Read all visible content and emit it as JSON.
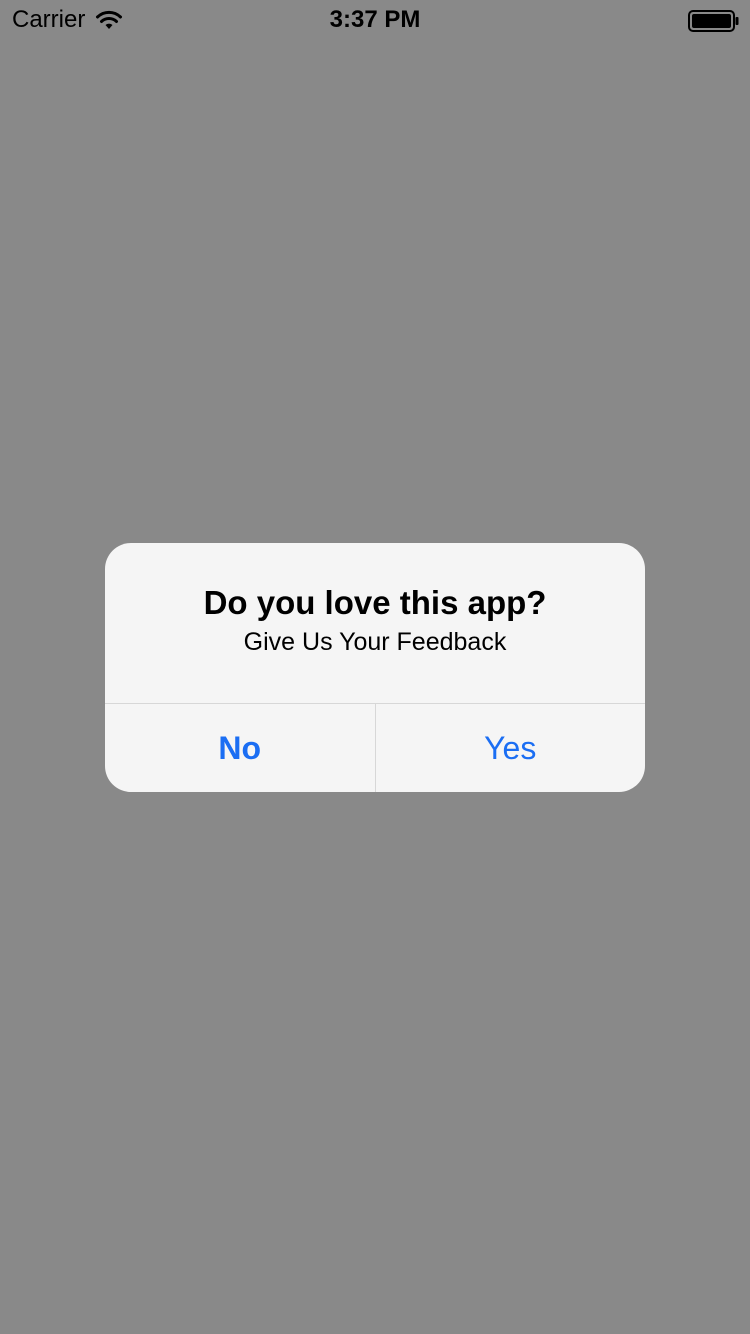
{
  "status_bar": {
    "carrier": "Carrier",
    "time": "3:37 PM",
    "wifi_icon": "wifi-icon",
    "battery_icon": "battery-full-icon"
  },
  "alert": {
    "title": "Do you love this app?",
    "message": "Give Us Your Feedback",
    "buttons": {
      "no": "No",
      "yes": "Yes"
    },
    "button_color": "#1b6ef3",
    "background_color": "#f5f5f5"
  },
  "screen": {
    "dim_color": "#898989"
  }
}
